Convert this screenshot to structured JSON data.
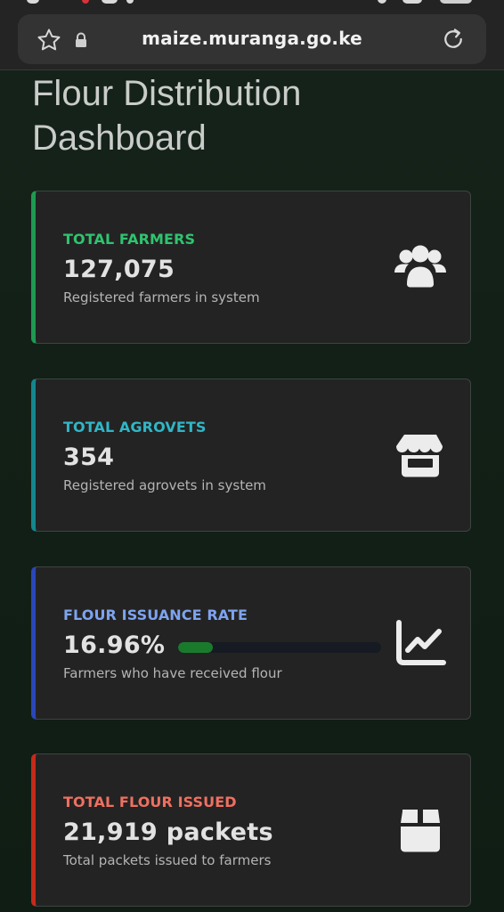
{
  "browser": {
    "url": "maize.muranga.go.ke",
    "star_icon": "star-outline-icon",
    "lock_icon": "lock-icon",
    "reload_icon": "reload-icon"
  },
  "page": {
    "title": "Flour Distribution Dashboard"
  },
  "cards": [
    {
      "label": "TOTAL FARMERS",
      "value": "127,075",
      "subtitle": "Registered farmers in system",
      "icon": "users-group-icon",
      "accent": "#1e9a52"
    },
    {
      "label": "TOTAL AGROVETS",
      "value": "354",
      "subtitle": "Registered agrovets in system",
      "icon": "store-icon",
      "accent": "#14868f"
    },
    {
      "label": "FLOUR ISSUANCE RATE",
      "value": "16.96%",
      "subtitle": "Farmers who have received flour",
      "icon": "line-chart-icon",
      "accent": "#2a46b8",
      "progress_percent": 16.96
    },
    {
      "label": "TOTAL FLOUR ISSUED",
      "value": "21,919 packets",
      "subtitle": "Total packets issued to farmers",
      "icon": "box-icon",
      "accent": "#c52a1a"
    }
  ]
}
